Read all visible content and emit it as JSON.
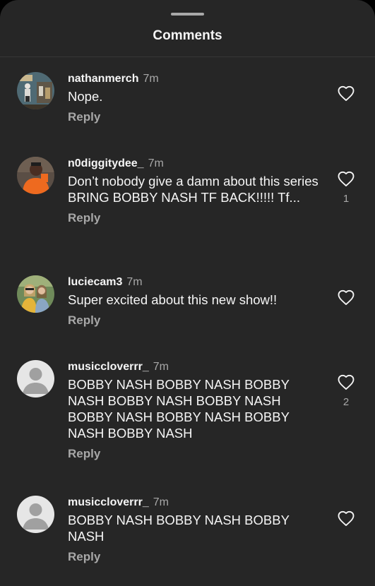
{
  "header": {
    "title": "Comments"
  },
  "comments": [
    {
      "username": "nathanmerch",
      "time": "7m",
      "text": "Nope.",
      "reply": "Reply",
      "likes": ""
    },
    {
      "username": "n0diggitydee_",
      "time": "7m",
      "text": "Don’t nobody give a damn about this series BRING BOBBY NASH TF BACK!!!!! Tf...",
      "reply": "Reply",
      "likes": "1"
    },
    {
      "username": "luciecam3",
      "time": "7m",
      "text": "Super excited about this new show!!",
      "reply": "Reply",
      "likes": ""
    },
    {
      "username": "musiccloverrr_",
      "time": "7m",
      "text": "BOBBY NASH BOBBY NASH BOBBY NASH BOBBY NASH BOBBY NASH BOBBY NASH BOBBY NASH BOBBY NASH BOBBY NASH",
      "reply": "Reply",
      "likes": "2"
    },
    {
      "username": "musiccloverrr_",
      "time": "7m",
      "text": "BOBBY NASH BOBBY NASH BOBBY NASH",
      "reply": "Reply",
      "likes": ""
    }
  ],
  "icons": {
    "like": "heart-outline-icon",
    "default_avatar": "default-avatar-icon"
  },
  "colors": {
    "background": "#262626",
    "text": "#f5f5f5",
    "secondary": "#a8a8a8"
  }
}
